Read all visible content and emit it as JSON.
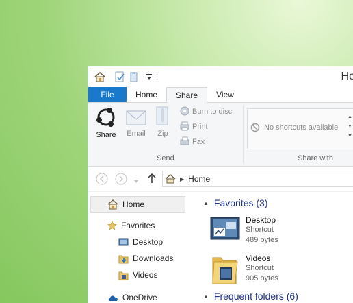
{
  "window": {
    "title": "Ho"
  },
  "tabs": [
    {
      "label": "File"
    },
    {
      "label": "Home"
    },
    {
      "label": "Share"
    },
    {
      "label": "View"
    }
  ],
  "ribbon": {
    "share_label": "Share",
    "email_label": "Email",
    "zip_label": "Zip",
    "burn_label": "Burn to disc",
    "print_label": "Print",
    "fax_label": "Fax",
    "send_group": "Send",
    "share_with_group": "Share with",
    "no_shortcuts": "No shortcuts available"
  },
  "address": {
    "location": "Home"
  },
  "nav": {
    "home": "Home",
    "favorites": "Favorites",
    "desktop": "Desktop",
    "downloads": "Downloads",
    "videos": "Videos",
    "onedrive": "OneDrive"
  },
  "content": {
    "favorites_header": "Favorites (3)",
    "frequent_header": "Frequent folders (6)",
    "items": [
      {
        "name": "Desktop",
        "type": "Shortcut",
        "size": "489 bytes"
      },
      {
        "name": "Videos",
        "type": "Shortcut",
        "size": "905 bytes"
      }
    ]
  },
  "colors": {
    "accent": "#1979ca",
    "header_text": "#1e3287"
  }
}
